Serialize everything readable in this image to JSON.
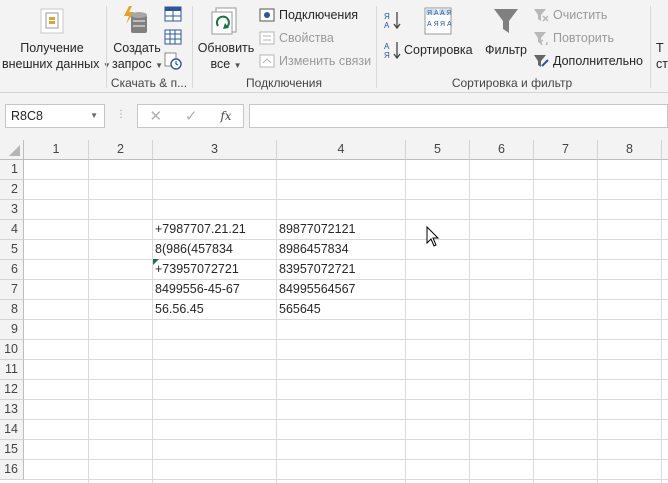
{
  "ribbon": {
    "get_data": {
      "label1": "Получение",
      "label2": "внешних данных"
    },
    "create_query": {
      "label1": "Создать",
      "label2": "запрос"
    },
    "group_get_transform": "Скачать & п...",
    "refresh_all": {
      "label1": "Обновить",
      "label2": "все"
    },
    "connections": {
      "label": "Подключения",
      "properties": "Свойства",
      "edit_links": "Изменить связи"
    },
    "group_connections": "Подключения",
    "sort": {
      "label": "Сортировка"
    },
    "filter": {
      "label": "Фильтр",
      "clear": "Очистить",
      "reapply": "Повторить",
      "advanced": "Дополнительно"
    },
    "group_sort_filter": "Сортировка и фильтр",
    "cut_off": {
      "label1": "Т",
      "label2": "ст"
    }
  },
  "formula_bar": {
    "name_box": "R8C8",
    "cancel": "✕",
    "enter": "✓",
    "fx": "fx",
    "formula": ""
  },
  "grid": {
    "columns": [
      "1",
      "2",
      "3",
      "4",
      "5",
      "6",
      "7",
      "8"
    ],
    "rows": [
      "1",
      "2",
      "3",
      "4",
      "5",
      "6",
      "7",
      "8",
      "9",
      "10",
      "11",
      "12",
      "13",
      "14",
      "15",
      "16"
    ],
    "cells": {
      "r4c3": "+7987707.21.21",
      "r4c4": "89877072121",
      "r5c3": "8(986(457834",
      "r5c4": "8986457834",
      "r6c3": "+73957072721",
      "r6c4": "83957072721",
      "r7c3": "8499556-45-67",
      "r7c4": "84995564567",
      "r8c3": "56.56.45",
      "r8c4": "565645"
    }
  },
  "colors": {
    "ribbon_bg": "#f3f3f3",
    "excel_green": "#1e7145",
    "grid_line": "#dadada"
  }
}
